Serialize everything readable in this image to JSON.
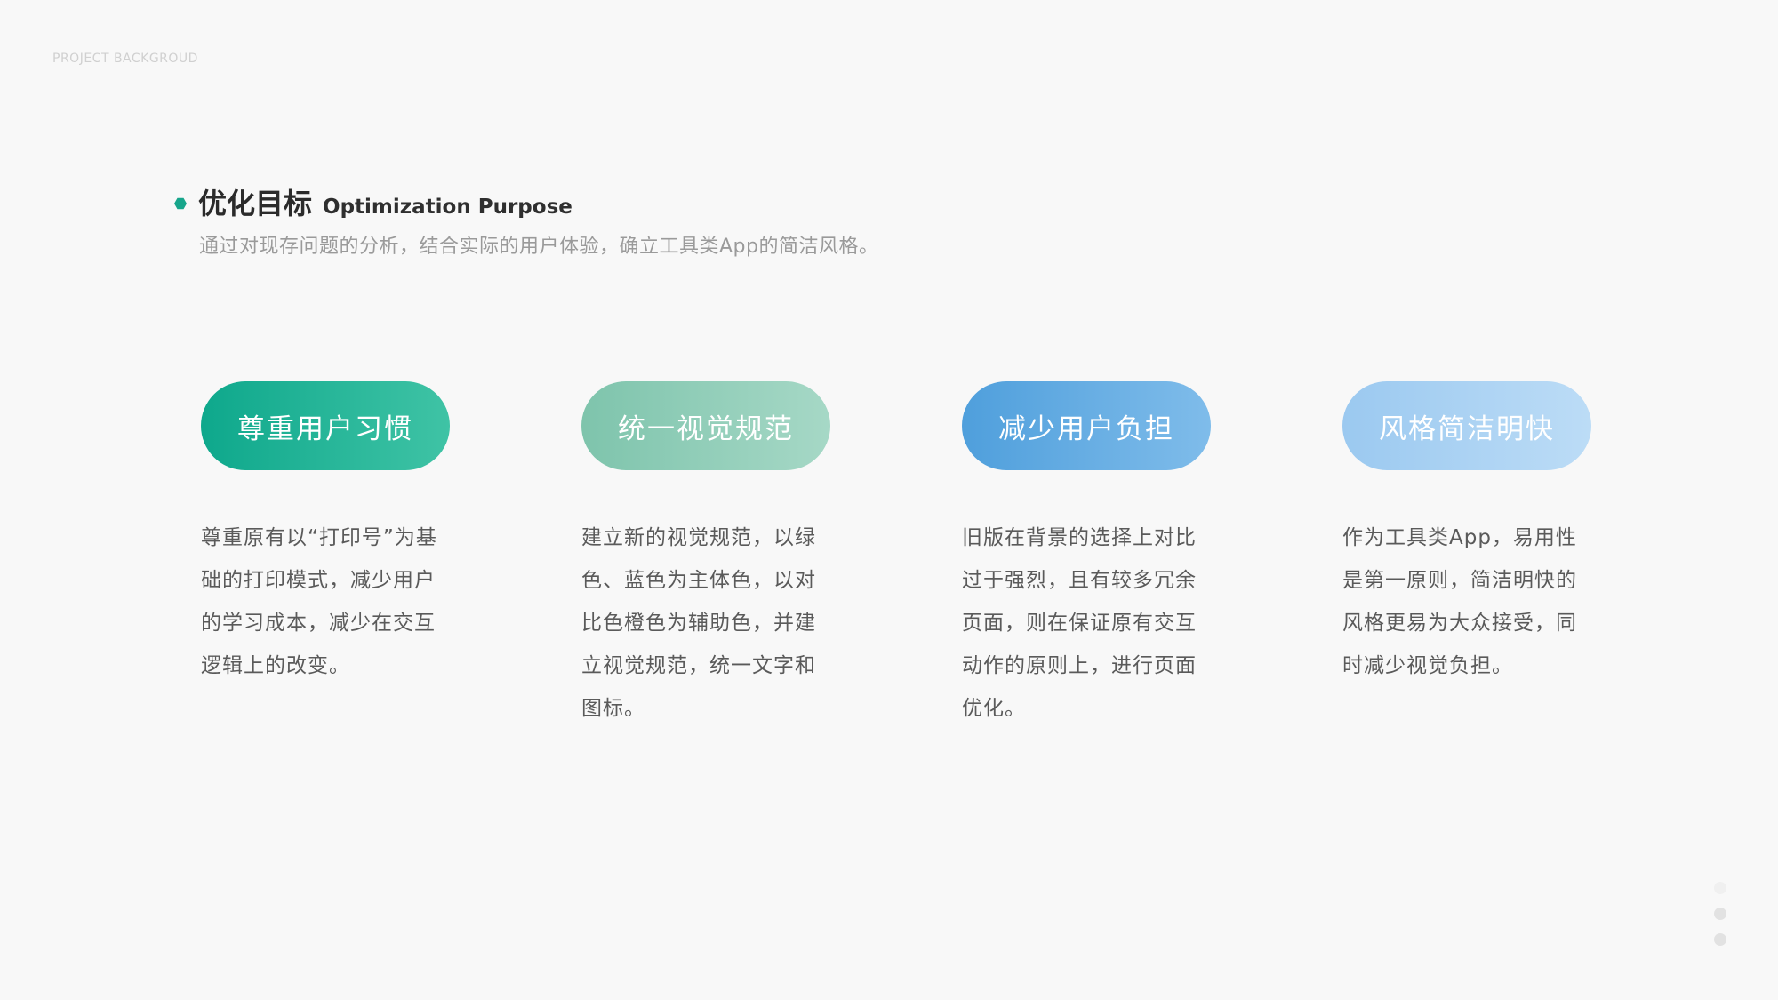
{
  "eyebrow": "PROJECT BACKGROUD",
  "section": {
    "title_cn": "优化目标",
    "title_en": "Optimization Purpose",
    "subtitle": "通过对现存问题的分析，结合实际的用户体验，确立工具类App的简洁风格。"
  },
  "cards": [
    {
      "label": "尊重用户习惯",
      "desc": "尊重原有以“打印号”为基础的打印模式，减少用户的学习成本，减少在交互逻辑上的改变。"
    },
    {
      "label": "统一视觉规范",
      "desc": "建立新的视觉规范，以绿色、蓝色为主体色，以对比色橙色为辅助色，并建立视觉规范，统一文字和图标。"
    },
    {
      "label": "减少用户负担",
      "desc": "旧版在背景的选择上对比过于强烈，且有较多冗余页面，则在保证原有交互动作的原则上，进行页面优化。"
    },
    {
      "label": "风格简洁明快",
      "desc": "作为工具类App，易用性是第一原则，简洁明快的风格更易为大众接受，同时减少视觉负担。"
    }
  ],
  "colors": {
    "accent": "#17a58b",
    "pill_1": "#0ea88c",
    "pill_2": "#7ec4ac",
    "pill_3": "#4f9fdc",
    "pill_4": "#9bc9f0"
  }
}
